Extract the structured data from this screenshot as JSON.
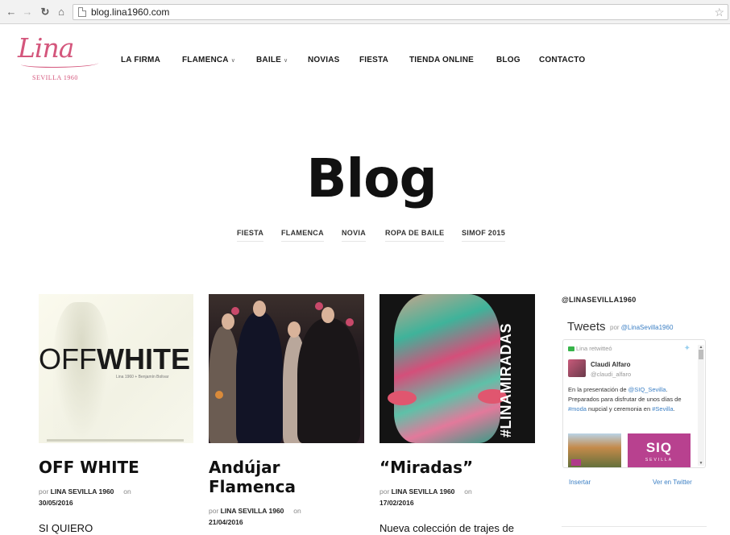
{
  "browser": {
    "url": "blog.lina1960.com",
    "back_icon": "arrow-left-icon",
    "forward_icon": "arrow-right-icon",
    "reload_icon": "reload-icon",
    "home_icon": "home-icon",
    "bookmark_icon": "star-icon"
  },
  "logo": {
    "script": "Lina",
    "subtitle": "SEVILLA 1960"
  },
  "menu": [
    {
      "label": "LA FIRMA",
      "dropdown": false
    },
    {
      "label": "FLAMENCA",
      "dropdown": true
    },
    {
      "label": "BAILE",
      "dropdown": true
    },
    {
      "label": "NOVIAS",
      "dropdown": false
    },
    {
      "label": "FIESTA",
      "dropdown": false
    },
    {
      "label": "TIENDA ONLINE",
      "dropdown": false
    },
    {
      "label": "BLOG",
      "dropdown": false
    },
    {
      "label": "CONTACTO",
      "dropdown": false
    }
  ],
  "hero": {
    "title": "Blog",
    "categories": [
      "FIESTA",
      "FLAMENCA",
      "NOVIA",
      "ROPA DE BAILE",
      "SIMOF 2015"
    ]
  },
  "posts": [
    {
      "image_text_light": "OFF",
      "image_text_bold": "WHITE",
      "image_caption": "Lina 1960 + Benjamín Bolivar",
      "title": "OFF WHITE",
      "by": "por",
      "author": "LINA SEVILLA 1960",
      "on": "on",
      "date": "30/05/2016",
      "excerpt": "SI QUIERO"
    },
    {
      "title_line1": "Andújar",
      "title_line2": "Flamenca",
      "by": "por",
      "author": "LINA SEVILLA 1960",
      "on": "on",
      "date": "21/04/2016"
    },
    {
      "image_hashtag": "#LINAMIRADAS",
      "title": "“Miradas”",
      "by": "por",
      "author": "LINA SEVILLA 1960",
      "on": "on",
      "date": "17/02/2016",
      "excerpt": "Nueva colección de trajes de"
    }
  ],
  "sidebar": {
    "heading": "@LINASEVILLA1960",
    "twitter": {
      "title": "Tweets",
      "by": "por",
      "account": "@LinaSevilla1960",
      "retweet_label": "Lina retwitteó",
      "author_name": "Claudi Alfaro",
      "author_handle": "@claudi_alfaro",
      "tweet_text_1": "En la presentación de ",
      "tweet_link_1": "@SIQ_Sevilla",
      "tweet_text_2": ". Preparados para disfrutar de unos días de ",
      "tweet_link_2": "#moda",
      "tweet_text_3": " nupcial y ceremonia en ",
      "tweet_link_3": "#Sevilla",
      "tweet_text_4": ".",
      "image2_title": "SIQ",
      "image2_subtitle": "SEVILLA",
      "embed_label": "Insertar",
      "view_label": "Ver en Twitter"
    }
  }
}
